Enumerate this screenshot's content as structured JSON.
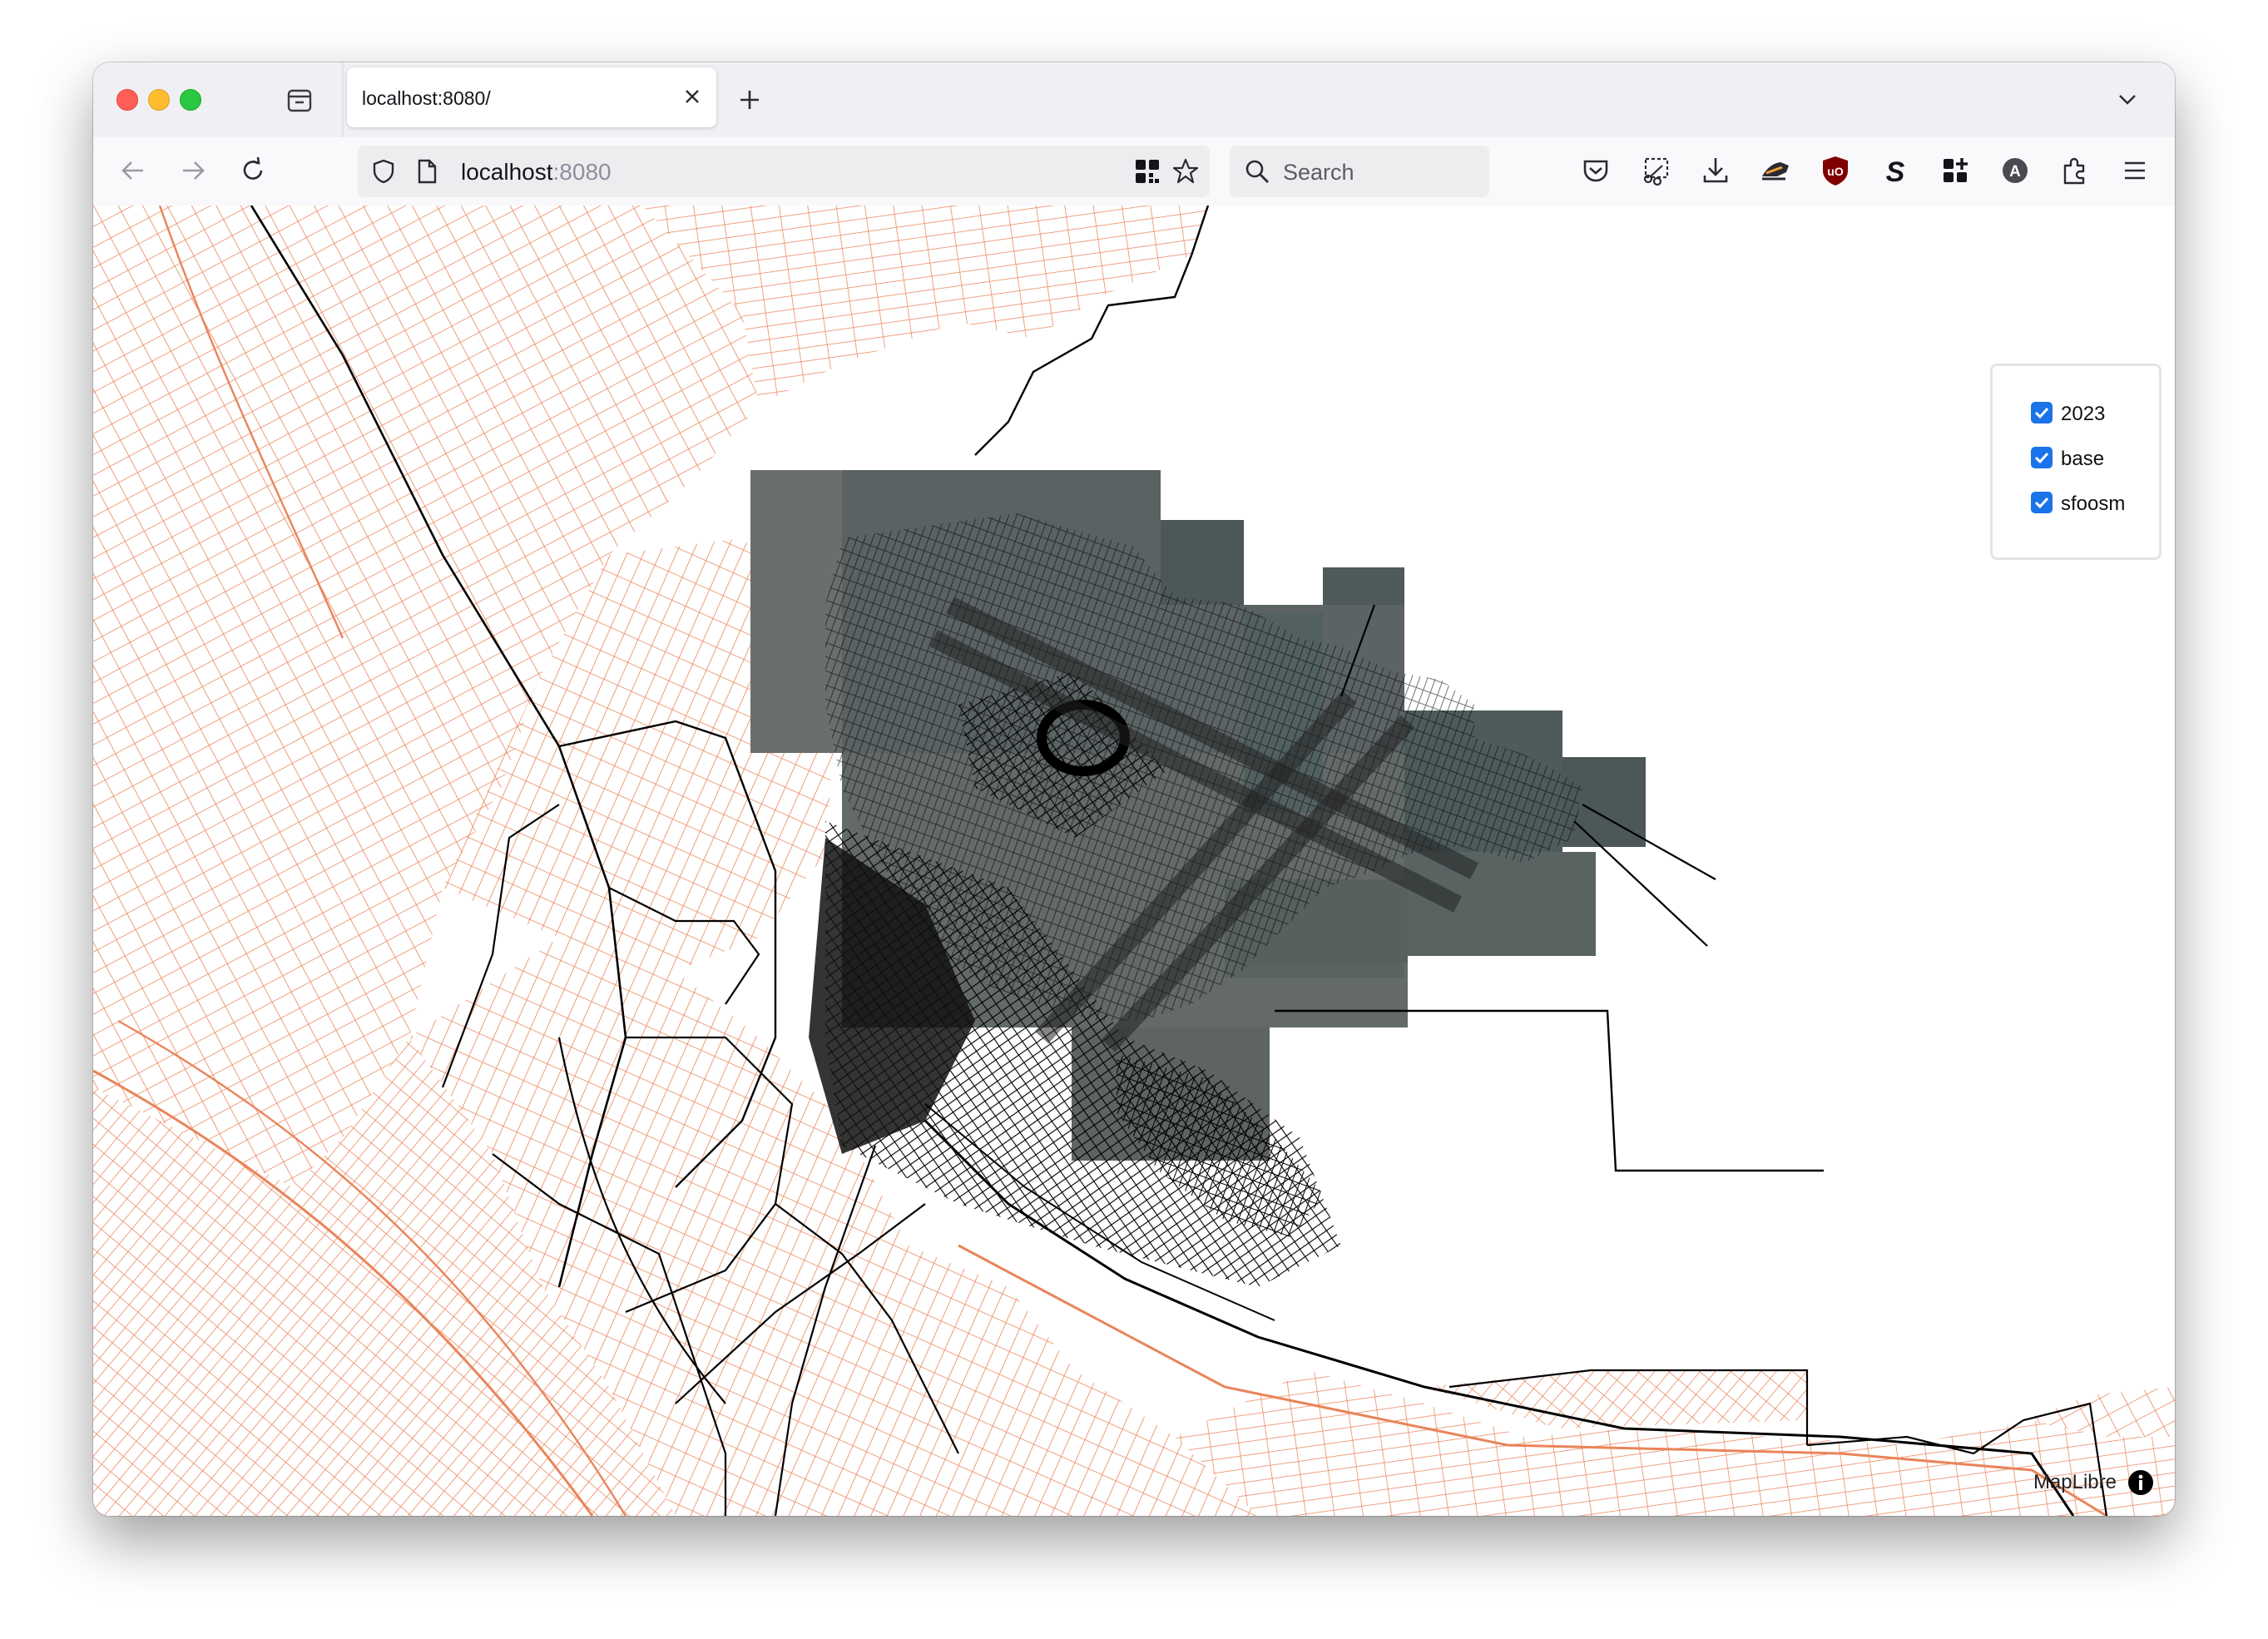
{
  "browser": {
    "tab": {
      "title": "localhost:8080/"
    },
    "url": {
      "host": "localhost",
      "port": ":8080"
    },
    "search": {
      "placeholder": "Search"
    },
    "icons": {
      "back": "arrow-left-icon",
      "forward": "arrow-right-icon",
      "reload": "reload-icon",
      "tab_list": "tab-list-icon",
      "close_tab": "close-icon",
      "new_tab": "plus-icon",
      "list_all_tabs": "chevron-down-icon",
      "tracking_protection": "shield-icon",
      "page_info": "page-icon",
      "qr_code": "qr-code-icon",
      "bookmark": "star-icon",
      "search": "search-icon",
      "pocket": "pocket-icon",
      "screenshot": "screenshot-icon",
      "downloads": "download-icon",
      "extension_1": "shoe-icon",
      "ublock": "ublock-origin-icon",
      "extension_s": "s-letter-icon",
      "extension_grid": "grid-plus-icon",
      "account": "account-a-icon",
      "extensions": "puzzle-icon",
      "menu": "hamburger-menu-icon"
    }
  },
  "layers": {
    "items": [
      {
        "label": "2023",
        "checked": true
      },
      {
        "label": "base",
        "checked": true
      },
      {
        "label": "sfoosm",
        "checked": true
      }
    ]
  },
  "map": {
    "attribution": "MapLibre",
    "attribution_icon": "info-icon",
    "colors": {
      "base_roads": "#e9845a",
      "osm_lines": "#000000",
      "checkbox": "#1a73e8"
    }
  }
}
